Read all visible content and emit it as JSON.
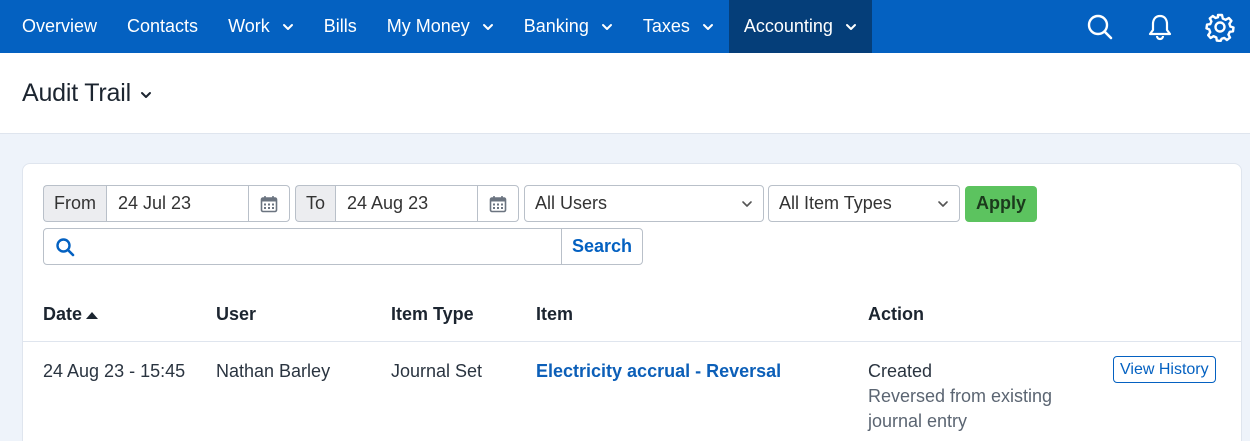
{
  "nav": {
    "items": [
      {
        "label": "Overview",
        "dropdown": false,
        "active": false
      },
      {
        "label": "Contacts",
        "dropdown": false,
        "active": false
      },
      {
        "label": "Work",
        "dropdown": true,
        "active": false
      },
      {
        "label": "Bills",
        "dropdown": false,
        "active": false
      },
      {
        "label": "My Money",
        "dropdown": true,
        "active": false
      },
      {
        "label": "Banking",
        "dropdown": true,
        "active": false
      },
      {
        "label": "Taxes",
        "dropdown": true,
        "active": false
      },
      {
        "label": "Accounting",
        "dropdown": true,
        "active": true
      }
    ],
    "icons": [
      "search-icon",
      "bell-icon",
      "gear-icon"
    ],
    "colors": {
      "bar": "#0461c1",
      "active": "#053e79"
    }
  },
  "page": {
    "title": "Audit Trail"
  },
  "filters": {
    "from_label": "From",
    "from_value": "24 Jul 23",
    "to_label": "To",
    "to_value": "24 Aug 23",
    "users_selected": "All Users",
    "item_types_selected": "All Item Types",
    "apply_label": "Apply"
  },
  "search": {
    "placeholder": "",
    "button_label": "Search"
  },
  "table": {
    "headers": {
      "date": "Date",
      "user": "User",
      "item_type": "Item Type",
      "item": "Item",
      "action": "Action"
    },
    "sort": {
      "column": "date",
      "direction": "ascending"
    },
    "rows": [
      {
        "date": "24 Aug 23 - 15:45",
        "user": "Nathan Barley",
        "item_type": "Journal Set",
        "item": "Electricity accrual - Reversal",
        "action": "Created",
        "action_detail_1": "Reversed from existing",
        "action_detail_2": "journal entry",
        "button_label": "View History"
      }
    ]
  }
}
